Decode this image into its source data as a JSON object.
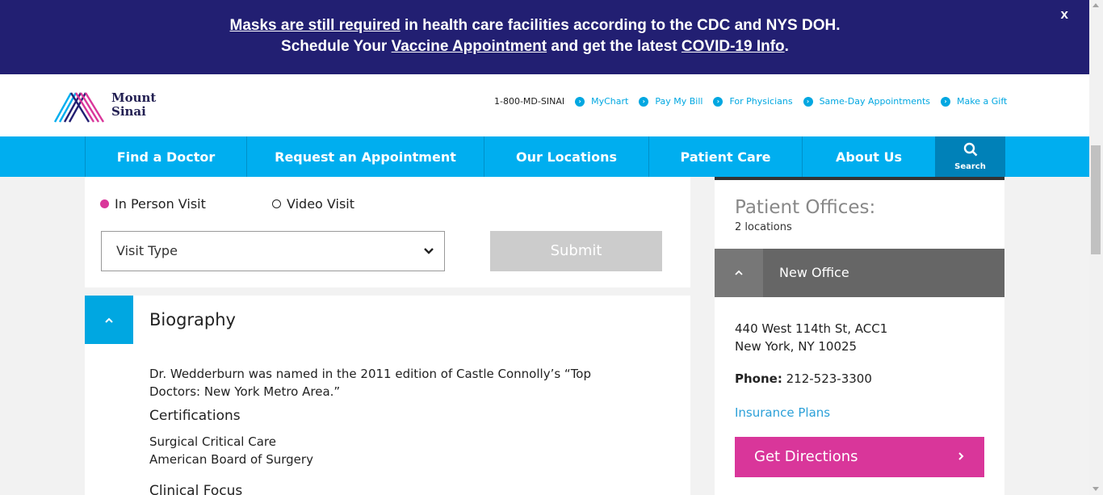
{
  "alert": {
    "line1_link": "Masks are still required",
    "line1_rest": " in health care facilities according to the CDC and NYS DOH.",
    "line2_pre": "Schedule Your ",
    "line2_link1": "Vaccine Appointment",
    "line2_mid": " and get the latest ",
    "line2_link2": "COVID-19 Info",
    "line2_end": ".",
    "close": "x"
  },
  "header": {
    "logo_line1": "Mount",
    "logo_line2": "Sinai",
    "phone": "1-800-MD-SINAI",
    "links": [
      "MyChart",
      "Pay My Bill",
      "For Physicians",
      "Same-Day Appointments",
      "Make a Gift"
    ]
  },
  "nav": {
    "items": [
      "Find a Doctor",
      "Request an Appointment",
      "Our Locations",
      "Patient Care",
      "About Us"
    ],
    "search": "Search"
  },
  "appointment": {
    "radio_in_person": "In Person Visit",
    "radio_video": "Video Visit",
    "visit_type": "Visit Type",
    "submit": "Submit"
  },
  "biography": {
    "title": "Biography",
    "text": "Dr. Wedderburn was named in the 2011 edition of Castle Connolly’s “Top Doctors: New York Metro Area.”",
    "certifications_heading": "Certifications",
    "certifications": [
      "Surgical Critical Care",
      "American Board of Surgery"
    ],
    "clinical_heading": "Clinical Focus"
  },
  "offices": {
    "title": "Patient Offices:",
    "count": "2 locations",
    "office_name": "New Office",
    "address_line1": "440 West 114th St, ACC1",
    "address_line2": "New York, NY 10025",
    "phone_label": "Phone:",
    "phone": "212-523-3300",
    "insurance": "Insurance Plans",
    "directions": "Get Directions"
  },
  "colors": {
    "banner": "#221f72",
    "nav": "#00aeef",
    "accent_pink": "#d9369a",
    "link_blue": "#00a7e1"
  }
}
